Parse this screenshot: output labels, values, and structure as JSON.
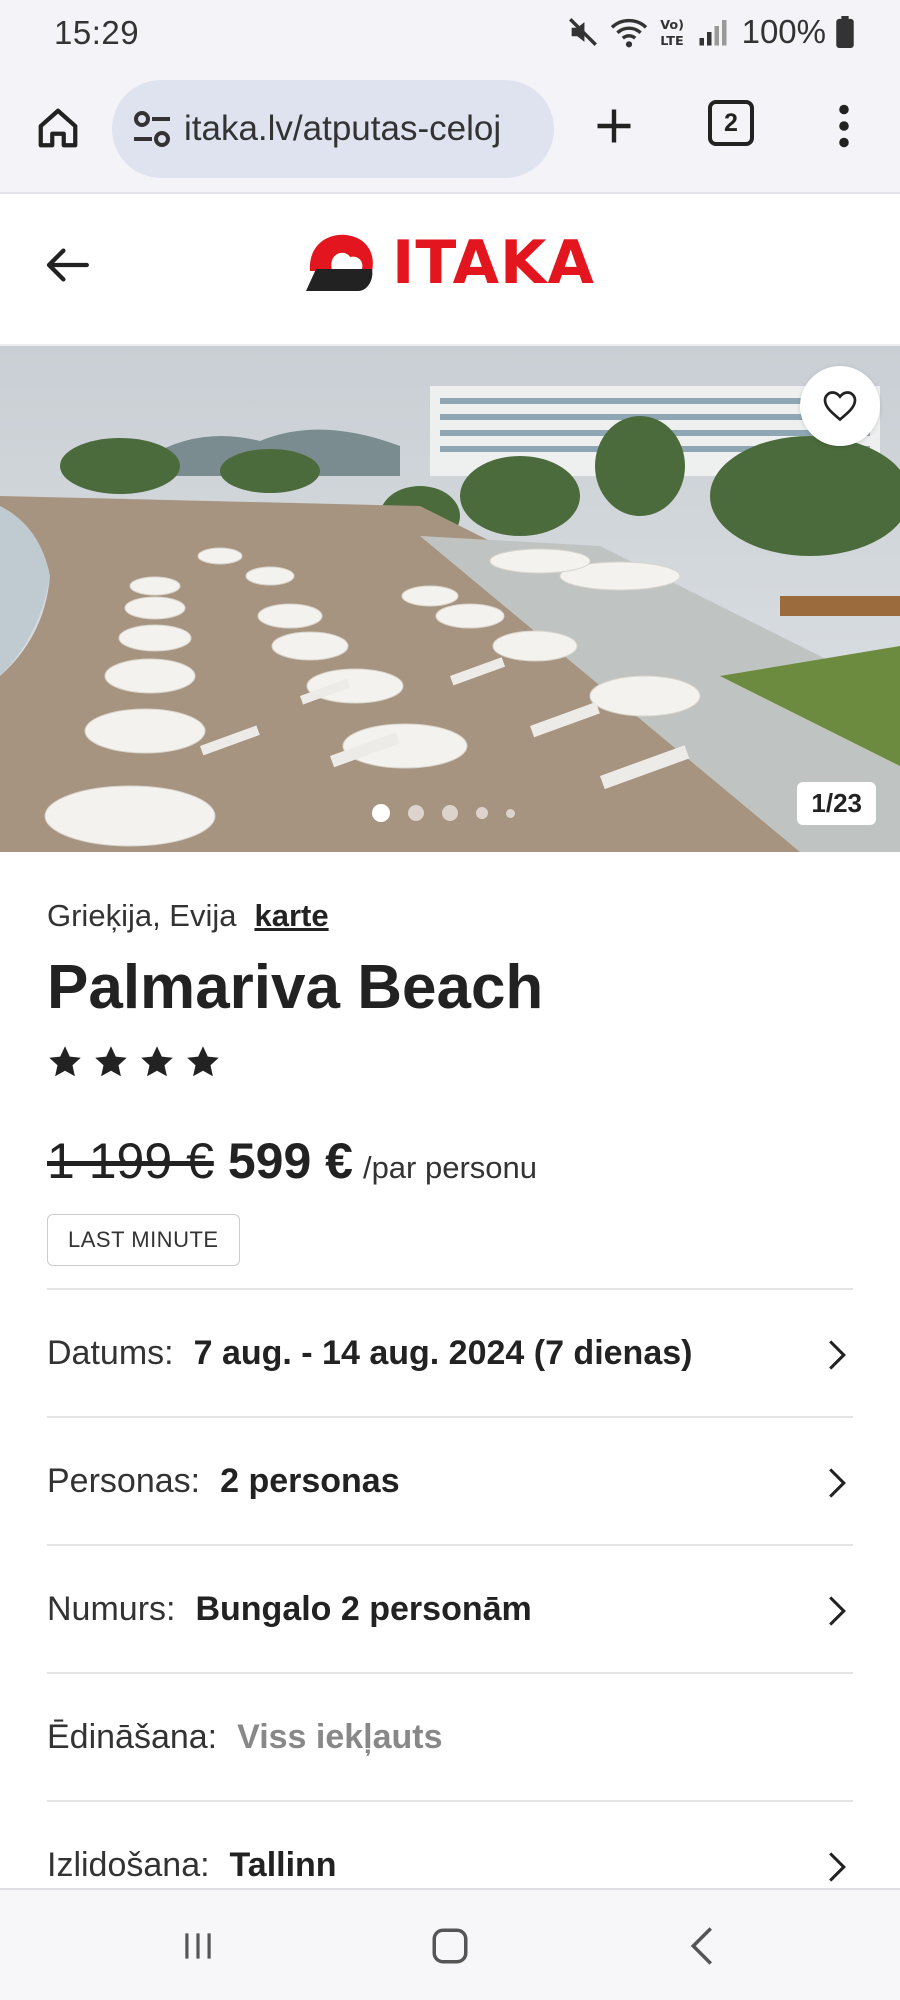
{
  "status_bar": {
    "time": "15:29",
    "battery": "100%",
    "icons": [
      "mute-icon",
      "wifi-icon",
      "volte-icon",
      "signal-icon",
      "battery-icon"
    ]
  },
  "browser": {
    "url": "itaka.lv/atputas-celoj",
    "tab_count": "2",
    "icons": [
      "home-icon",
      "site-settings-icon",
      "plus-icon",
      "tabs-icon",
      "more-vert-icon"
    ]
  },
  "site_header": {
    "logo_text": "ITAKA",
    "brand_color": "#e3161f"
  },
  "gallery": {
    "counter": "1/23",
    "dots_total": 5,
    "active_dot": 0
  },
  "hotel": {
    "location": "Grieķija, Evija",
    "map_link": "karte",
    "name": "Palmariva Beach",
    "stars": 4,
    "old_price": "1 199 €",
    "new_price": "599 €",
    "per_person": "/par personu",
    "badge": "LAST MINUTE"
  },
  "details": [
    {
      "label": "Datums:",
      "value": "7 aug. - 14 aug. 2024 (7 dienas)",
      "chevron": true,
      "muted": false
    },
    {
      "label": "Personas:",
      "value": "2 personas",
      "chevron": true,
      "muted": false
    },
    {
      "label": "Numurs:",
      "value": "Bungalo 2 personām",
      "chevron": true,
      "muted": false
    },
    {
      "label": "Ēdināšana:",
      "value": "Viss iekļauts",
      "chevron": false,
      "muted": true
    },
    {
      "label": "Izlidošana:",
      "value": "Tallinn",
      "chevron": true,
      "muted": false
    }
  ]
}
